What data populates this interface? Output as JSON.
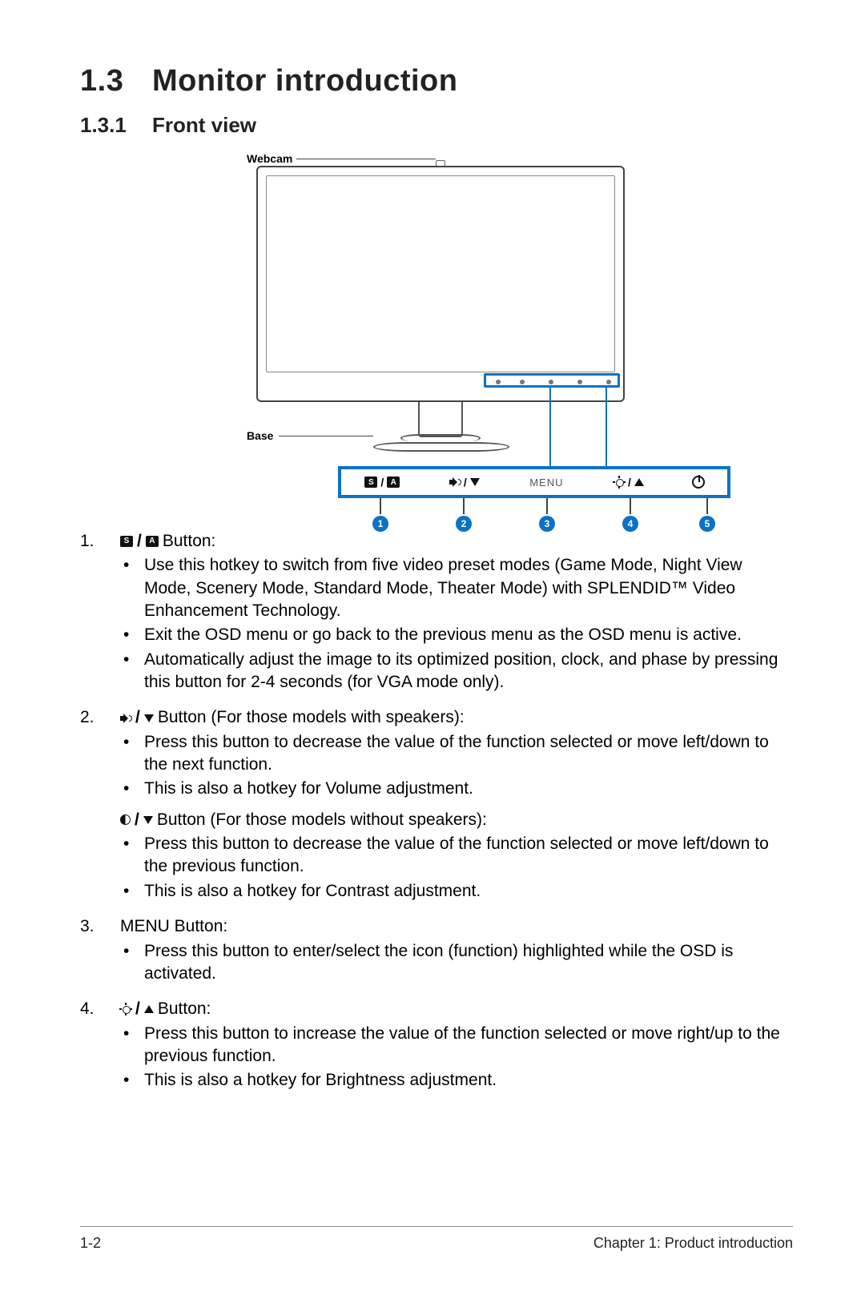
{
  "heading": {
    "number": "1.3",
    "title": "Monitor introduction"
  },
  "subheading": {
    "number": "1.3.1",
    "title": "Front view"
  },
  "diagram": {
    "webcam_label": "Webcam",
    "base_label": "Base",
    "bar_menu_label": "MENU",
    "bar_sa_s": "S",
    "bar_sa_a": "A",
    "badges": [
      "1",
      "2",
      "3",
      "4",
      "5"
    ]
  },
  "items": [
    {
      "n": "1.",
      "label_suffix": "Button:",
      "icons": "SA",
      "bullets": [
        "Use this hotkey to switch from five video preset modes (Game Mode, Night View Mode, Scenery Mode, Standard Mode, Theater Mode) with SPLENDID™ Video Enhancement Technology.",
        "Exit the OSD menu or go back to the previous menu as the OSD menu is active.",
        "Automatically adjust the image to its optimized position, clock, and phase by pressing this button for 2-4 seconds (for VGA mode only)."
      ]
    },
    {
      "n": "2.",
      "label_suffix": "Button (For those models with speakers):",
      "icons": "VOLDOWN",
      "bullets": [
        "Press this button to decrease the value of the function selected or move left/down to the next function.",
        "This is also a hotkey for Volume adjustment."
      ],
      "label2_suffix": "Button (For those models without speakers):",
      "icons2": "CONTRASTDOWN",
      "bullets2": [
        "Press this button to decrease the value of the function selected or move left/down to the previous function.",
        "This is also a hotkey for Contrast adjustment."
      ]
    },
    {
      "n": "3.",
      "label_text": "MENU Button:",
      "bullets": [
        "Press this button to enter/select the icon (function) highlighted while the OSD is activated."
      ]
    },
    {
      "n": "4.",
      "label_suffix": "Button:",
      "icons": "SUNUP",
      "bullets": [
        "Press this button to increase the value of the function selected or move right/up to the previous function.",
        "This is also a hotkey for Brightness adjustment."
      ]
    }
  ],
  "footer": {
    "left": "1-2",
    "right": "Chapter 1: Product introduction"
  }
}
